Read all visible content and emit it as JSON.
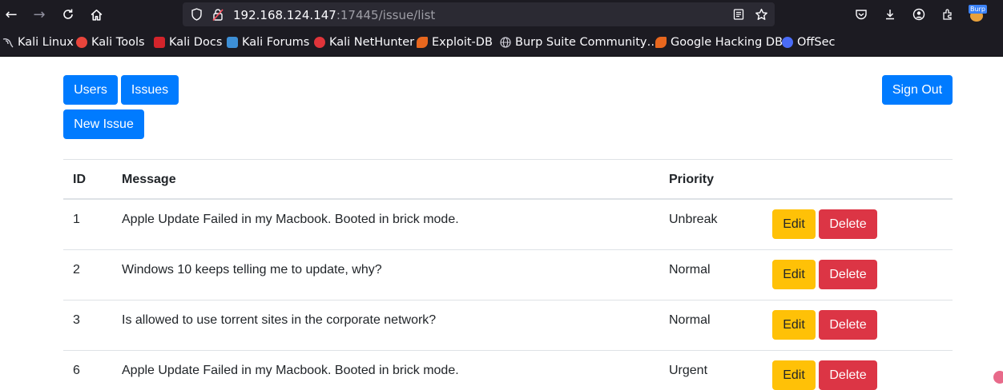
{
  "browser": {
    "url_host": "192.168.124.147",
    "url_rest": ":17445/issue/list",
    "bookmarks": [
      {
        "label": "Kali Linux",
        "icon": "kali-dragon-icon",
        "color": "#cfcfd8"
      },
      {
        "label": "Kali Tools",
        "icon": "kali-tools-icon",
        "color": "#e8453c"
      },
      {
        "label": "Kali Docs",
        "icon": "kali-docs-icon",
        "color": "#d3242b"
      },
      {
        "label": "Kali Forums",
        "icon": "kali-forums-icon",
        "color": "#3d8fd6"
      },
      {
        "label": "Kali NetHunter",
        "icon": "nethunter-icon",
        "color": "#e0343a"
      },
      {
        "label": "Exploit-DB",
        "icon": "exploit-db-icon",
        "color": "#e8671e"
      },
      {
        "label": "Burp Suite Community…",
        "icon": "globe-icon",
        "color": "#cfcfd8"
      },
      {
        "label": "Google Hacking DB",
        "icon": "ghdb-icon",
        "color": "#e8671e"
      },
      {
        "label": "OffSec",
        "icon": "offsec-icon",
        "color": "#4a6cf7"
      }
    ],
    "extension_badge": "Burp"
  },
  "nav": {
    "users_label": "Users",
    "issues_label": "Issues",
    "new_issue_label": "New Issue",
    "sign_out_label": "Sign Out"
  },
  "table": {
    "headers": {
      "id": "ID",
      "message": "Message",
      "priority": "Priority"
    },
    "rows": [
      {
        "id": "1",
        "message": "Apple Update Failed in my Macbook. Booted in brick mode.",
        "priority": "Unbreak",
        "edit": "Edit",
        "delete": "Delete"
      },
      {
        "id": "2",
        "message": "Windows 10 keeps telling me to update, why?",
        "priority": "Normal",
        "edit": "Edit",
        "delete": "Delete"
      },
      {
        "id": "3",
        "message": "Is allowed to use torrent sites in the corporate network?",
        "priority": "Normal",
        "edit": "Edit",
        "delete": "Delete"
      },
      {
        "id": "6",
        "message": "Apple Update Failed in my Macbook. Booted in brick mode.",
        "priority": "Urgent",
        "edit": "Edit",
        "delete": "Delete"
      }
    ]
  },
  "colors": {
    "primary": "#007bff",
    "warning": "#ffc107",
    "danger": "#dc3545",
    "chrome_bg": "#1c1b22"
  }
}
